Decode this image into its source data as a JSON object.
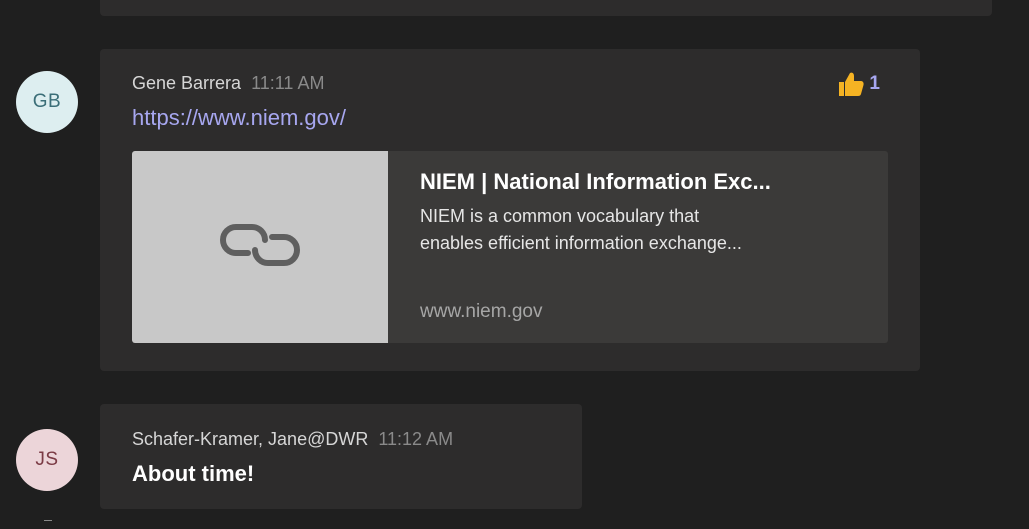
{
  "messages": [
    {
      "avatar_initials": "GB",
      "author": "Gene Barrera",
      "time": "11:11 AM",
      "link": "https://www.niem.gov/",
      "reaction": {
        "icon": "thumbs-up-icon",
        "count": "1"
      },
      "preview": {
        "icon": "link-icon",
        "title": "NIEM | National Information Exc...",
        "description_lines": [
          "NIEM is a common vocabulary that",
          "enables efficient information exchange..."
        ],
        "domain": "www.niem.gov"
      }
    },
    {
      "avatar_initials": "JS",
      "author": "Schafer-Kramer, Jane@DWR",
      "time": "11:12 AM",
      "text": "About time!"
    }
  ],
  "colors": {
    "background": "#1f1f1f",
    "bubble": "#2d2c2c",
    "link": "#a7a7f0",
    "reaction_thumb": "#f5b323"
  }
}
